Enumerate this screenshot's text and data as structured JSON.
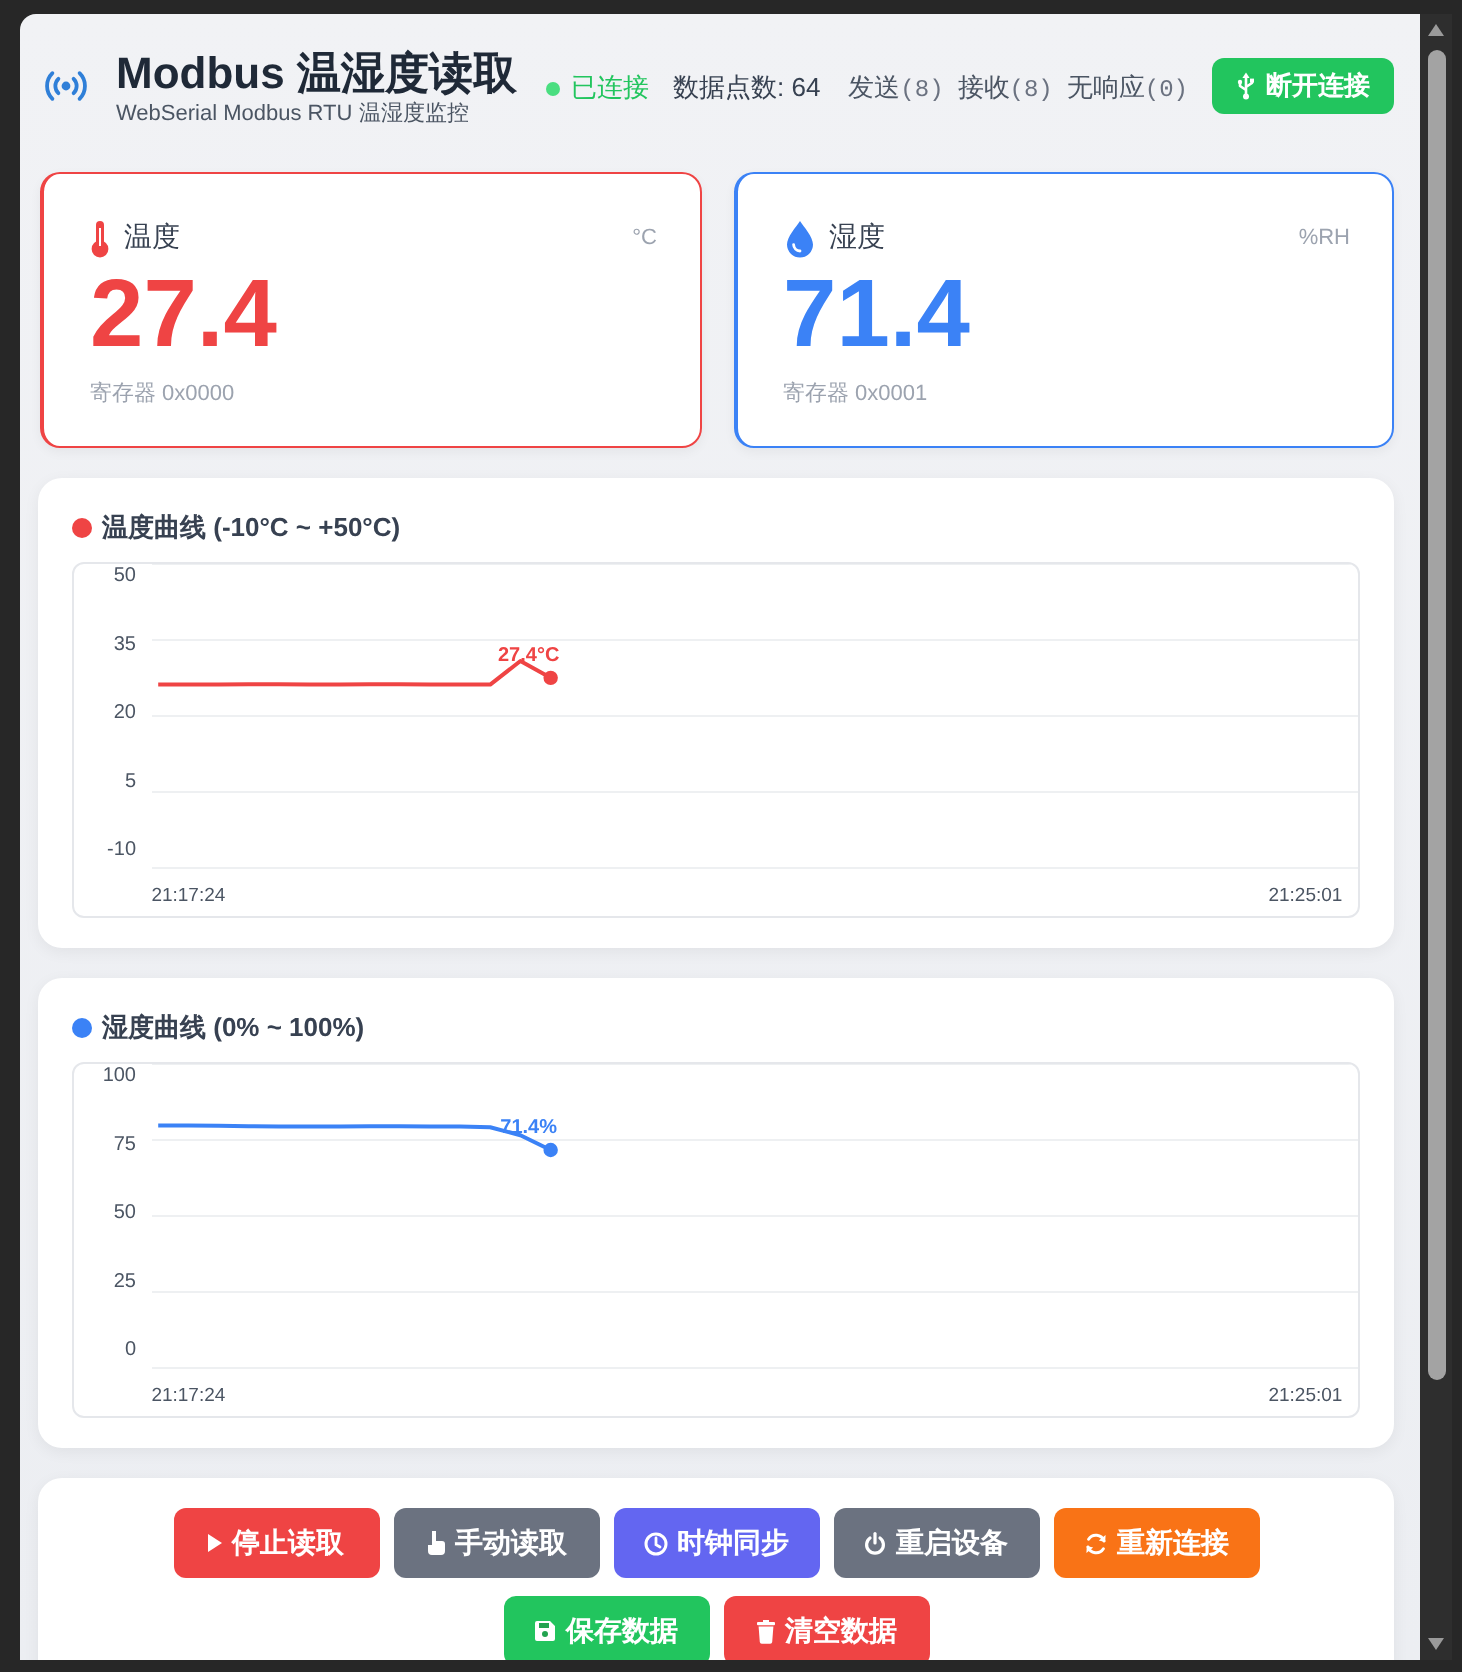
{
  "header": {
    "title": "Modbus 温湿度读取",
    "subtitle": "WebSerial Modbus RTU 温湿度监控",
    "status": {
      "label": "已连接",
      "connected": true
    },
    "data_points": "数据点数: 64",
    "counters": [
      {
        "label": "发送",
        "count": "(8)"
      },
      {
        "label": "接收",
        "count": "(8)"
      },
      {
        "label": "无响应",
        "count": "(0)"
      }
    ],
    "disconnect_button": "断开连接"
  },
  "readings": [
    {
      "kind": "temperature",
      "label": "温度",
      "unit": "°C",
      "value": "27.4",
      "register": "寄存器 0x0000",
      "color": "#ef4444"
    },
    {
      "kind": "humidity",
      "label": "湿度",
      "unit": "%RH",
      "value": "71.4",
      "register": "寄存器 0x0001",
      "color": "#3b82f6"
    }
  ],
  "charts": [
    {
      "title": "温度曲线 (-10°C ~ +50°C)",
      "color": "#ef4444",
      "chart_data": {
        "type": "line",
        "categories": [
          null,
          "21:17:24",
          null,
          null,
          null,
          null,
          null,
          null,
          null,
          null,
          null,
          null,
          null,
          null,
          null,
          null,
          null,
          null,
          null,
          null,
          null,
          null,
          null,
          null,
          null,
          null,
          null,
          null,
          null,
          null,
          null,
          null,
          null,
          null,
          null,
          null,
          null,
          null,
          "21:25:01"
        ],
        "series": [
          {
            "color": "#ef4444",
            "values": [
              26.2,
              26.2,
              26.2,
              26.3,
              26.3,
              26.2,
              26.2,
              26.3,
              26.3,
              26.2,
              26.2,
              26.2,
              31.4,
              27.7,
              null,
              null,
              null,
              null,
              null,
              null,
              null,
              null,
              null,
              null,
              null,
              null,
              null,
              null,
              null,
              null,
              null,
              null,
              null,
              null,
              null,
              null,
              null,
              null,
              null
            ]
          }
        ],
        "ylim": [
          -10,
          50
        ],
        "yticks": [
          -10,
          5,
          20,
          35,
          50
        ],
        "annotations": [
          {
            "y": 27.7,
            "text": "27.4°C"
          }
        ]
      }
    },
    {
      "title": "湿度曲线 (0% ~ 100%)",
      "color": "#3b82f6",
      "chart_data": {
        "type": "line",
        "categories": [
          null,
          "21:17:24",
          null,
          null,
          null,
          null,
          null,
          null,
          null,
          null,
          null,
          null,
          null,
          null,
          null,
          null,
          null,
          null,
          null,
          null,
          null,
          null,
          null,
          null,
          null,
          null,
          null,
          null,
          null,
          null,
          null,
          null,
          null,
          null,
          null,
          null,
          null,
          null,
          "21:25:01"
        ],
        "series": [
          {
            "color": "#3b82f6",
            "values": [
              81.9,
              81.9,
              81.8,
              81.7,
              81.6,
              81.5,
              81.6,
              81.7,
              81.7,
              81.6,
              81.5,
              81.3,
              78.4,
              73.0,
              null,
              null,
              null,
              null,
              null,
              null,
              null,
              null,
              null,
              null,
              null,
              null,
              null,
              null,
              null,
              null,
              null,
              null,
              null,
              null,
              null,
              null,
              null,
              null,
              null
            ]
          }
        ],
        "ylim": [
          0,
          100
        ],
        "yticks": [
          0,
          25,
          50,
          75,
          100
        ],
        "annotations": [
          {
            "y": 73.0,
            "text": "71.4%"
          }
        ]
      }
    }
  ],
  "controls": [
    {
      "label": "停止读取",
      "kind": "play",
      "color": "#ef4444"
    },
    {
      "label": "手动读取",
      "kind": "hand",
      "color": "#6b7280"
    },
    {
      "label": "时钟同步",
      "kind": "clock",
      "color": "#6366f1"
    },
    {
      "label": "重启设备",
      "kind": "power",
      "color": "#6b7280"
    },
    {
      "label": "重新连接",
      "kind": "sync",
      "color": "#f97316"
    },
    {
      "label": "保存数据",
      "kind": "save",
      "color": "#22c55e"
    },
    {
      "label": "清空数据",
      "kind": "trash",
      "color": "#ef4444"
    }
  ]
}
